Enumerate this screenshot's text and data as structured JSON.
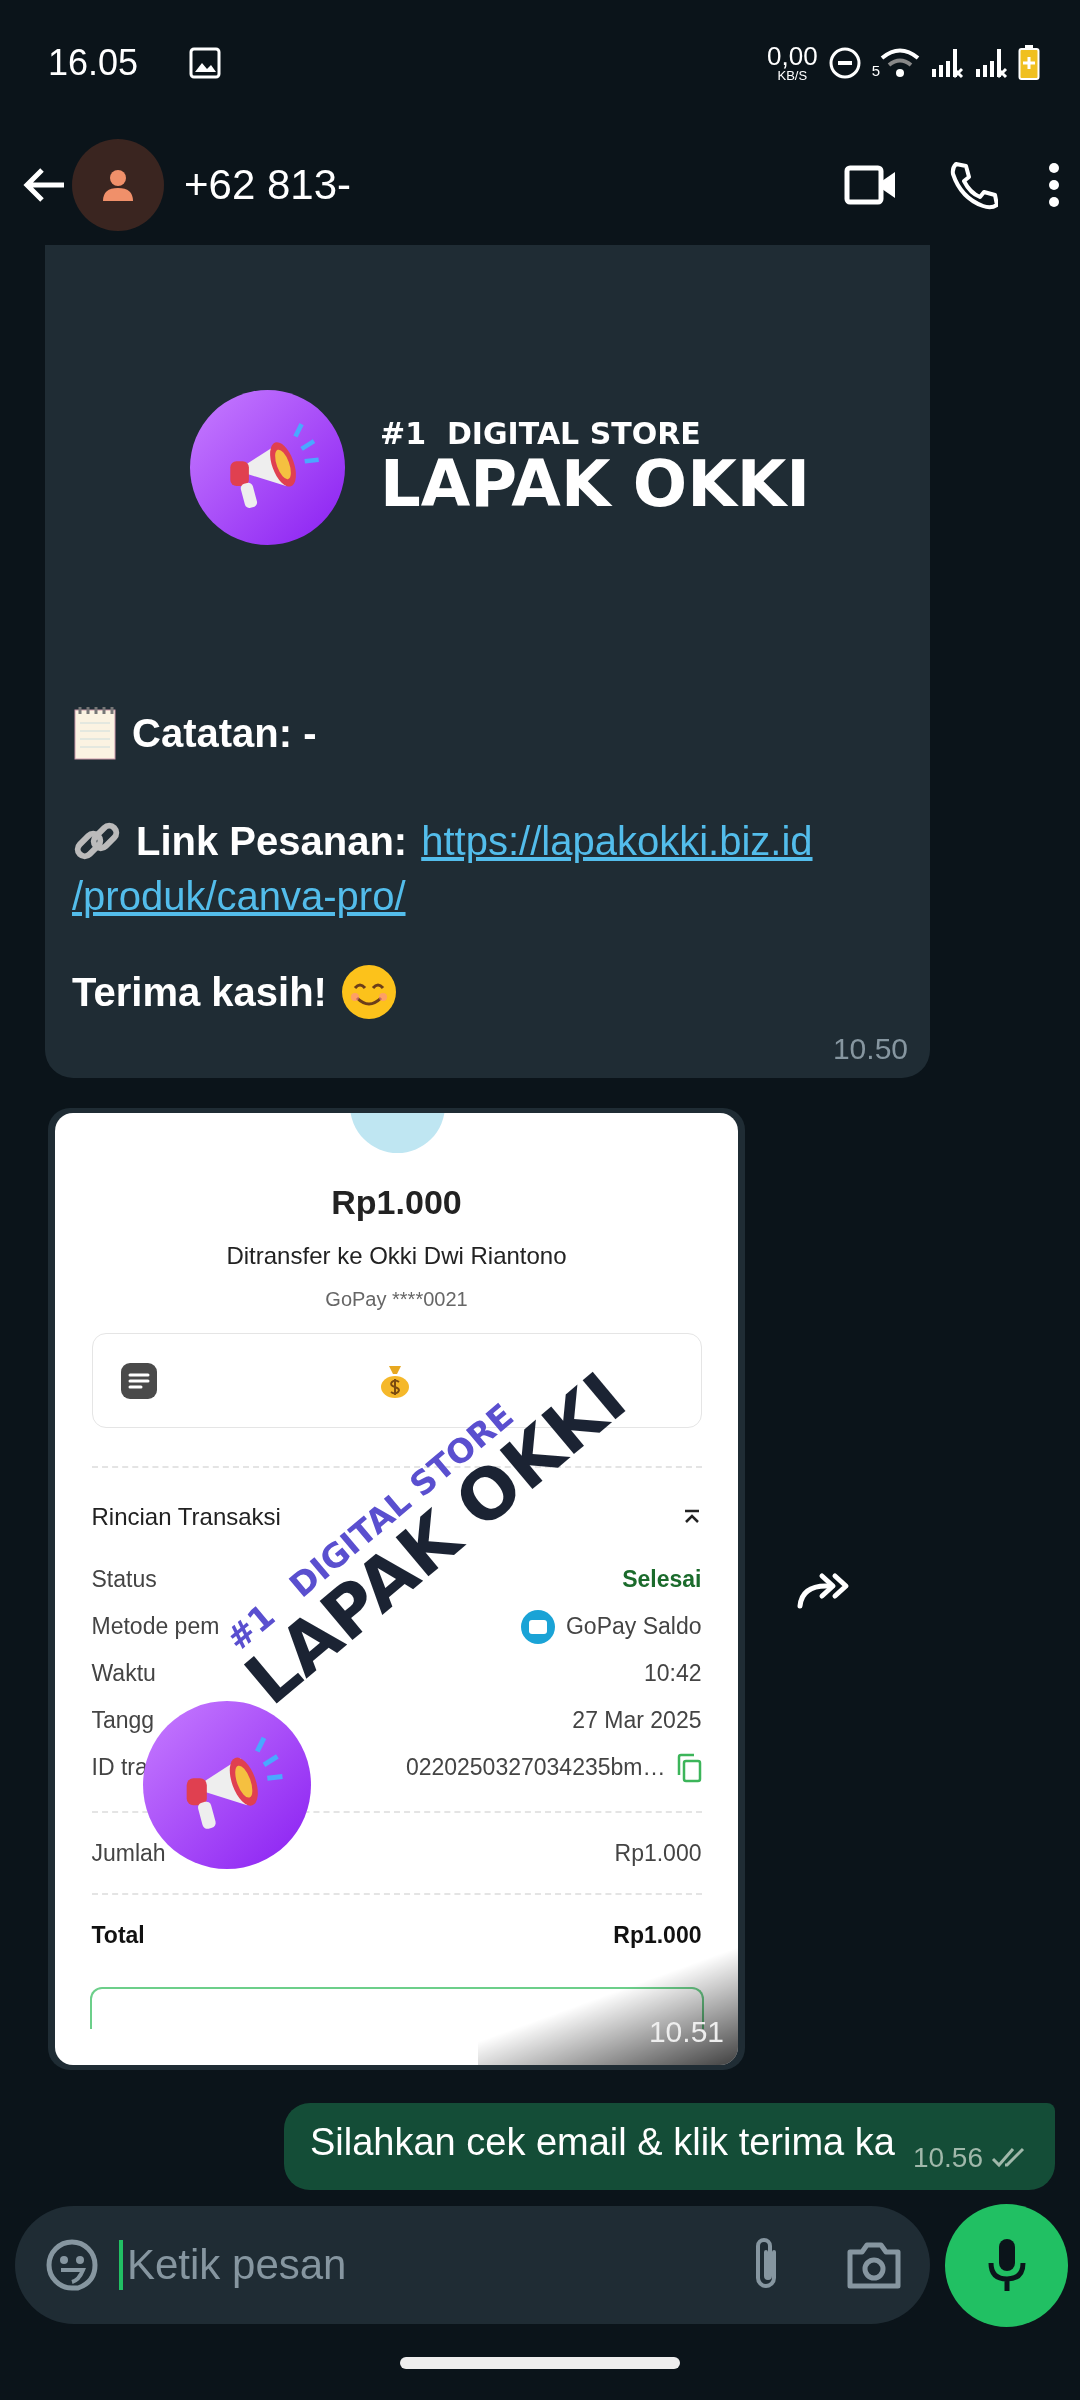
{
  "status_bar": {
    "time": "16.05",
    "net_speed": "0,00",
    "net_unit": "KB/S",
    "wifi_band": "5"
  },
  "header": {
    "contact": "+62 813-"
  },
  "messages": [
    {
      "kind": "store_card",
      "tagline": "#1  DIGITAL STORE",
      "brand": "LAPAK OKKI",
      "note": "Catatan: -",
      "link_label": "Link Pesanan:",
      "link_lines": [
        "https://lapakokki.biz.id",
        "/produk/canva-pro/"
      ],
      "thanks": "Terima kasih!",
      "time": "10.50"
    },
    {
      "kind": "receipt_image",
      "amount": "Rp1.000",
      "recipient": "Ditransfer ke Okki Dwi Riantono",
      "account": "GoPay ****0021",
      "section": "Rincian Transaksi",
      "rows": [
        {
          "kind": "status",
          "label": "Status",
          "value": "Selesai"
        },
        {
          "kind": "method",
          "label": "Metode pem",
          "value": "GoPay Saldo"
        },
        {
          "kind": "plain",
          "label": "Waktu",
          "value": "10:42"
        },
        {
          "kind": "plain",
          "label": "Tangg",
          "value": "27 Mar 2025"
        },
        {
          "kind": "copy",
          "label": "ID tra",
          "value": "0220250327034235bm…"
        }
      ],
      "subtotal_label": "Jumlah",
      "subtotal": "Rp1.000",
      "total_label": "Total",
      "total": "Rp1.000",
      "overlay_tagline": [
        "#1",
        "DIGITAL STORE"
      ],
      "overlay_brand": [
        "LAPAK",
        "OKKI"
      ],
      "time": "10.51"
    },
    {
      "kind": "text",
      "text": "Silahkan cek email & klik terima ka",
      "time": "10.56",
      "read": false
    }
  ],
  "composer": {
    "placeholder": "Ketik pesan"
  }
}
